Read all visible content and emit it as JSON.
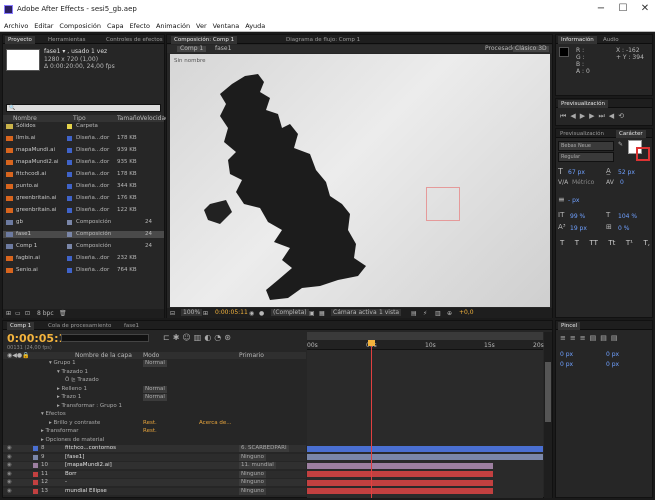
{
  "window": {
    "title": "Adobe After Effects - sesi5_gb.aep",
    "minimize": "−",
    "maximize": "☐",
    "close": "✕"
  },
  "menu": [
    "Archivo",
    "Editar",
    "Composición",
    "Capa",
    "Efecto",
    "Animación",
    "Ver",
    "Ventana",
    "Ayuda"
  ],
  "project": {
    "tabs": [
      "Proyecto",
      "Herramientas",
      "Controles de efectos"
    ],
    "selected_name": "fase1 ▾ , usado 1 vez",
    "selected_info1": "1280 x 720 (1,00)",
    "selected_info2": "Δ 0:00:20:00, 24,00 fps",
    "search_placeholder": "🔍",
    "columns": [
      "Nombre",
      "Tipo",
      "Tamaño",
      "Velocidad"
    ],
    "items": [
      {
        "name": "Sólidos",
        "type": "Carpeta",
        "size": "",
        "fps": "",
        "color": "#e5d34a",
        "icon": "folder",
        "indent": 0
      },
      {
        "name": "Ilmis.ai",
        "type": "Diseña...dor",
        "size": "178 KB",
        "fps": "",
        "color": "#3f63c9",
        "icon": "ai",
        "indent": 0
      },
      {
        "name": "mapaMundi.ai",
        "type": "Diseña...dor",
        "size": "939 KB",
        "fps": "",
        "color": "#3f63c9",
        "icon": "ai",
        "indent": 0
      },
      {
        "name": "mapaMundi2.ai",
        "type": "Diseña...dor",
        "size": "935 KB",
        "fps": "",
        "color": "#3f63c9",
        "icon": "ai",
        "indent": 0
      },
      {
        "name": "fitchcodi.ai",
        "type": "Diseña...dor",
        "size": "178 KB",
        "fps": "",
        "color": "#3f63c9",
        "icon": "ai",
        "indent": 0
      },
      {
        "name": "punto.ai",
        "type": "Diseña...dor",
        "size": "344 KB",
        "fps": "",
        "color": "#3f63c9",
        "icon": "ai",
        "indent": 0
      },
      {
        "name": "greenbritain.ai",
        "type": "Diseña...dor",
        "size": "176 KB",
        "fps": "",
        "color": "#3f63c9",
        "icon": "ai",
        "indent": 0
      },
      {
        "name": "greenbritain.ai",
        "type": "Diseña...dor",
        "size": "122 KB",
        "fps": "",
        "color": "#3f63c9",
        "icon": "ai",
        "indent": 0
      },
      {
        "name": "gb",
        "type": "Composición",
        "size": "",
        "fps": "24",
        "color": "#7a86a8",
        "icon": "comp",
        "indent": 0
      },
      {
        "name": "fase1",
        "type": "Composición",
        "size": "",
        "fps": "24",
        "color": "#7a86a8",
        "icon": "comp",
        "indent": 0,
        "selected": true
      },
      {
        "name": "Comp 1",
        "type": "Composición",
        "size": "",
        "fps": "24",
        "color": "#7a86a8",
        "icon": "comp",
        "indent": 0
      },
      {
        "name": "fagbin.ai",
        "type": "Diseña...dor",
        "size": "232 KB",
        "fps": "",
        "color": "#3f63c9",
        "icon": "ai",
        "indent": 0
      },
      {
        "name": "Senio.ai",
        "type": "Diseña...dor",
        "size": "764 KB",
        "fps": "",
        "color": "#3f63c9",
        "icon": "ai",
        "indent": 0
      }
    ],
    "bit_depth": "8 bpc"
  },
  "composition": {
    "tab1": "Composición: Comp 1",
    "tab2": "Diagrama de flujo: Comp 1",
    "subtab1": "Comp 1",
    "subtab2": "fase1",
    "camera": "Cámara activa",
    "renderer_label": "Procesador:",
    "renderer_value": "Clásico 3D",
    "zoom": "100%",
    "resolution": "(Completa)",
    "timecode_small": "0:00:05:11",
    "view_mode": "1 vista",
    "overlay_label": "Sin nombre",
    "exposure": "+0,0"
  },
  "info_panel": {
    "tabs": [
      "Información",
      "Audio"
    ],
    "r": "R :",
    "g": "G :",
    "b": "B :",
    "a": "A : 0",
    "x": "X : -162",
    "y": "+ Y : 394"
  },
  "preview": {
    "tab": "Previsualización"
  },
  "character": {
    "tabs": [
      "Previsualización",
      "Carácter"
    ],
    "font": "Bebas Neue",
    "style": "Regular",
    "size": "67 px",
    "leading": "52 px",
    "tracking": "0",
    "kerning": "Métrico",
    "stroke": "- px",
    "scale_v": "99 %",
    "scale_h": "104 %",
    "baseline": "19 px",
    "tsume": "0 %",
    "format_buttons": [
      "T",
      "T",
      "TT",
      "Tt",
      "T¹",
      "T,"
    ]
  },
  "paragraph": {
    "tab": "Párrafo",
    "indent1": "0 px",
    "indent2": "0 px",
    "indent3": "0 px",
    "indent4": "0 px",
    "indent5": "0 px"
  },
  "timeline": {
    "tabs": [
      "Comp 1",
      "Cola de procesamiento",
      "fase1"
    ],
    "timecode": "0:00:05:11",
    "frames": "00131 (24,00 fps)",
    "columns": [
      "Nombre de la capa",
      "Modo",
      "Primario"
    ],
    "ruler": [
      "00s",
      "05s",
      "10s",
      "15s",
      "20s"
    ],
    "playhead_fraction": 0.27,
    "layers": [
      {
        "name": "▾ Grupo 1",
        "mode": "Normal",
        "parent": "",
        "indent": 2,
        "color": ""
      },
      {
        "name": "▾ Trazado 1",
        "mode": "",
        "parent": "",
        "indent": 3,
        "color": ""
      },
      {
        "name": "Ö ⊵ Trazado",
        "mode": "",
        "parent": "",
        "indent": 4,
        "color": ""
      },
      {
        "name": "▸ Relleno 1",
        "mode": "Normal",
        "parent": "",
        "indent": 3,
        "color": ""
      },
      {
        "name": "▸ Trazo 1",
        "mode": "Normal",
        "parent": "",
        "indent": 3,
        "color": ""
      },
      {
        "name": "▸ Transformar : Grupo 1",
        "mode": "",
        "parent": "",
        "indent": 3,
        "color": ""
      },
      {
        "name": "▾ Efectos",
        "mode": "",
        "parent": "",
        "indent": 1,
        "color": ""
      },
      {
        "name": "▸ Brillo y contraste",
        "mode": "Rest.",
        "parent": "Acerca de...",
        "indent": 2,
        "color": ""
      },
      {
        "name": "▸ Transformar",
        "mode": "Rest.",
        "parent": "",
        "indent": 1,
        "color": ""
      },
      {
        "name": "▸ Opciones de material",
        "mode": "",
        "parent": "",
        "indent": 1,
        "color": ""
      },
      {
        "num": "8",
        "name": "fitchco...contornos",
        "mode": "",
        "parent": "6. SCARBEDPARI",
        "indent": 0,
        "color": "#4a6fd1",
        "bar": [
          0.0,
          1.0
        ]
      },
      {
        "num": "9",
        "name": "[fase1]",
        "mode": "",
        "parent": "Ninguno",
        "indent": 0,
        "color": "#7a86a8",
        "bar": [
          0.0,
          1.0
        ]
      },
      {
        "num": "10",
        "name": "[mapaMundi2.ai]",
        "mode": "",
        "parent": "11. mundial",
        "indent": 0,
        "color": "#9d7fa0",
        "bar": [
          0.0,
          0.79
        ]
      },
      {
        "num": "11",
        "name": "Borr",
        "mode": "",
        "parent": "Ninguno",
        "indent": 0,
        "color": "#c24040",
        "bar": [
          0.0,
          0.79
        ]
      },
      {
        "num": "12",
        "name": "-",
        "mode": "",
        "parent": "Ninguno",
        "indent": 0,
        "color": "#c24040",
        "bar": [
          0.0,
          0.79
        ]
      },
      {
        "num": "13",
        "name": "mundial Ellipse",
        "mode": "",
        "parent": "Ninguno",
        "indent": 0,
        "color": "#c24040",
        "bar": [
          0.0,
          0.79
        ]
      }
    ]
  },
  "paint": {
    "tab": "Pincel",
    "v1": "0 px",
    "v2": "0 px",
    "v3": "0 px",
    "v4": "0 px"
  }
}
